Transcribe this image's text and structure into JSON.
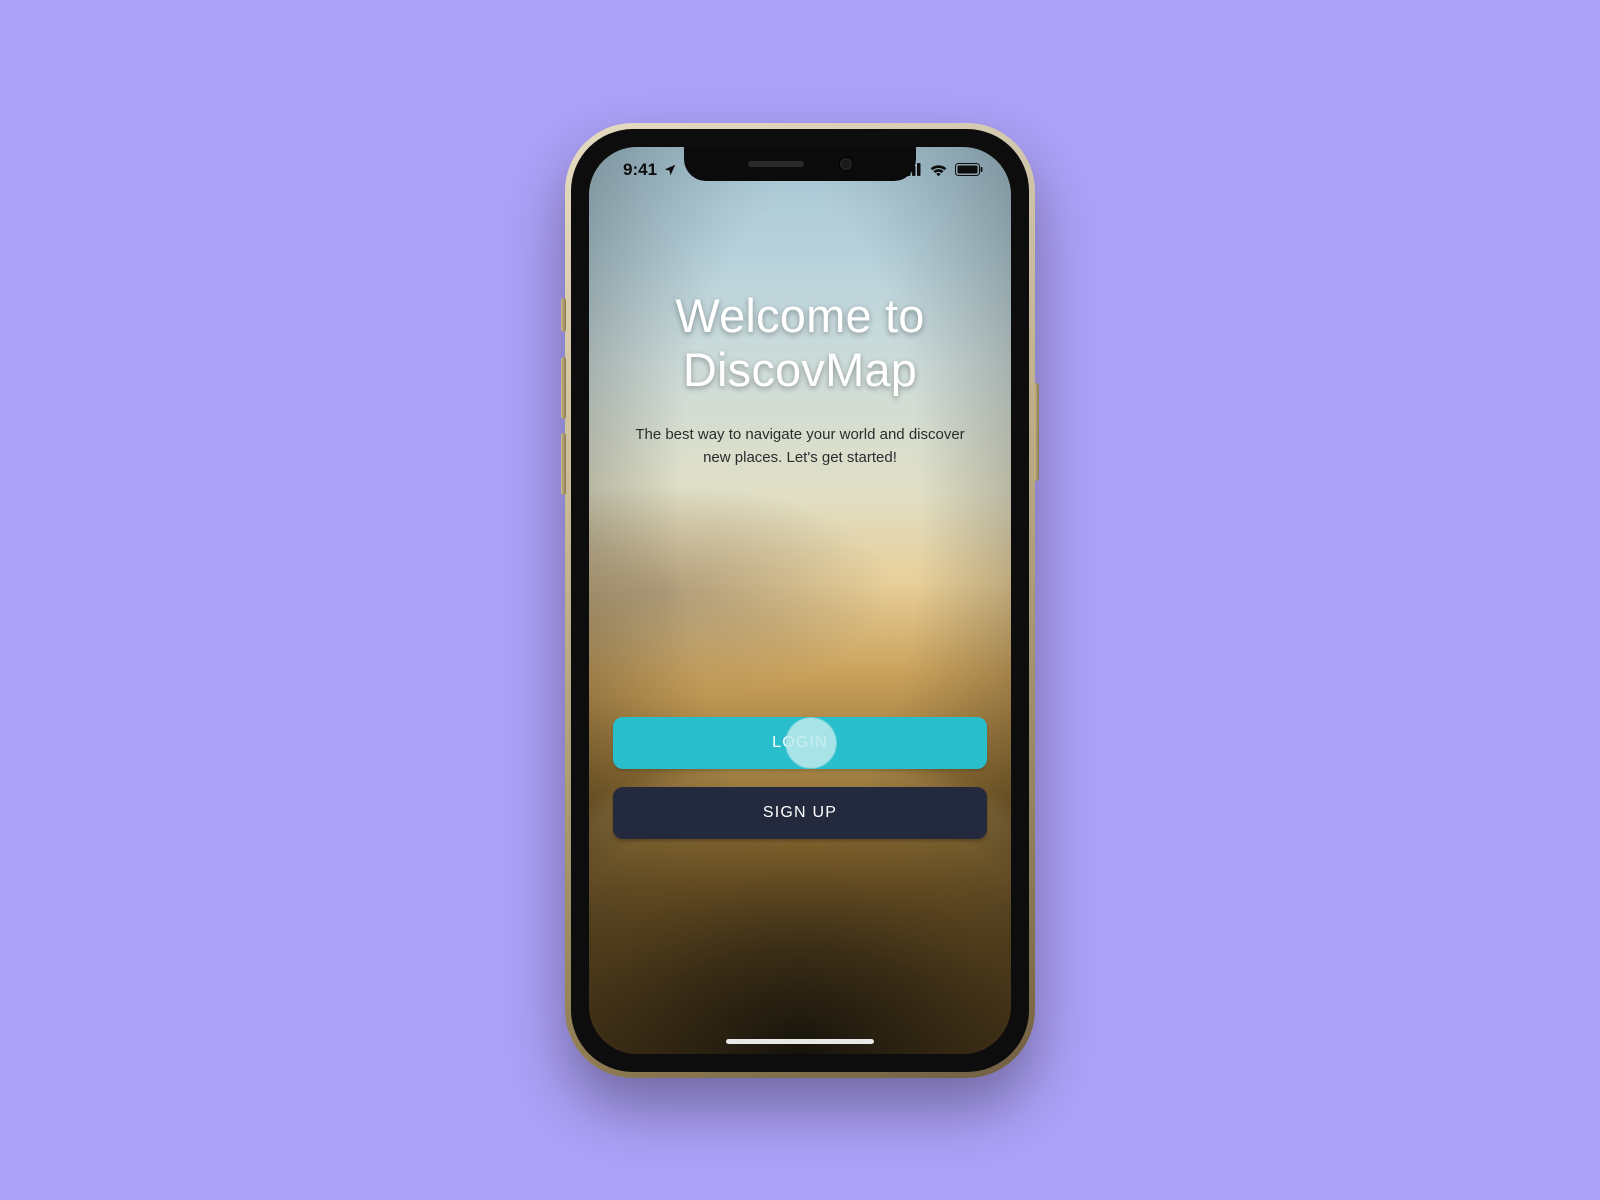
{
  "status_bar": {
    "time": "9:41",
    "location_icon": "location-arrow-icon",
    "cellular_icon": "cellular-icon",
    "wifi_icon": "wifi-icon",
    "battery_icon": "battery-icon"
  },
  "welcome": {
    "title_line1": "Welcome to",
    "title_line2": "DiscovMap",
    "subtitle": "The best way to navigate your world and discover new places. Let's get started!"
  },
  "buttons": {
    "login": "LOGIN",
    "signup": "SIGN UP"
  },
  "colors": {
    "canvas": "#ADA1F8",
    "login_button": "#29BECB",
    "signup_button": "#242A3E"
  }
}
